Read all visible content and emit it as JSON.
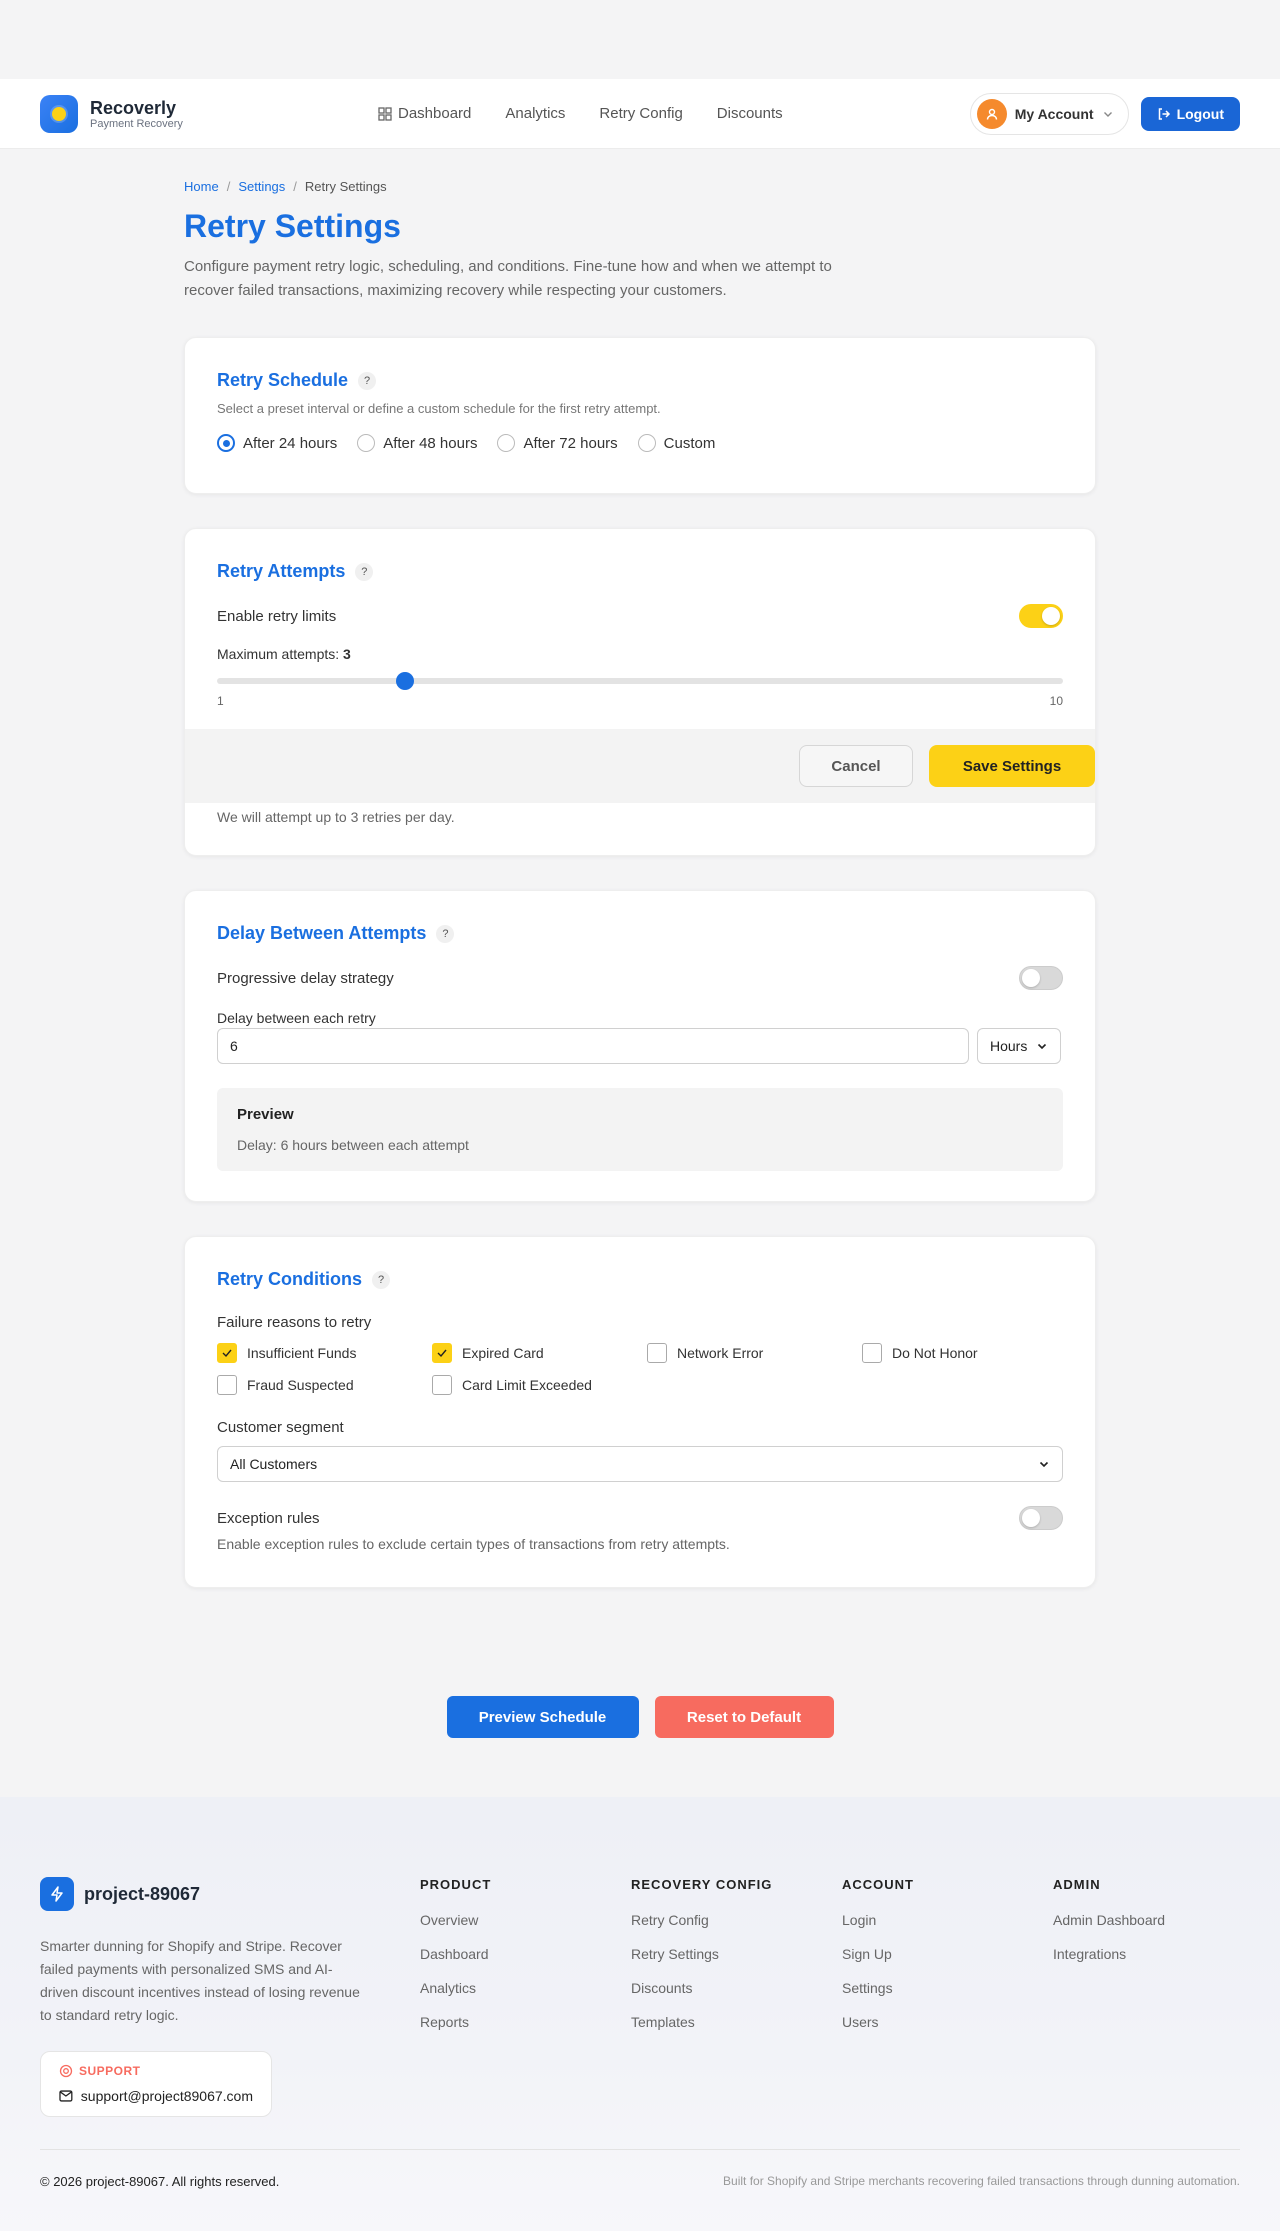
{
  "header": {
    "brand_name": "Recoverly",
    "brand_sub": "Payment Recovery",
    "nav": [
      "Dashboard",
      "Analytics",
      "Retry Config",
      "Discounts"
    ],
    "account_label": "My Account",
    "logout_label": "Logout"
  },
  "breadcrumb": {
    "home": "Home",
    "settings": "Settings",
    "current": "Retry Settings"
  },
  "page": {
    "title": "Retry Settings",
    "intro": "Configure payment retry logic, scheduling, and conditions. Fine-tune how and when we attempt to recover failed transactions, maximizing recovery while respecting your customers."
  },
  "schedule": {
    "title": "Retry Schedule",
    "help": "?",
    "desc": "Select a preset interval or define a custom schedule for the first retry attempt.",
    "options": [
      "After 24 hours",
      "After 48 hours",
      "After 72 hours",
      "Custom"
    ],
    "selected": "After 24 hours"
  },
  "attempts": {
    "title": "Retry Attempts",
    "help": "?",
    "enable_label": "Enable retry limits",
    "enabled": true,
    "max_label": "Maximum attempts:",
    "max_value": "3",
    "min": "1",
    "max": "10",
    "note": "We will attempt up to 3 retries per day.",
    "cancel": "Cancel",
    "save": "Save Settings"
  },
  "delay": {
    "title": "Delay Between Attempts",
    "help": "?",
    "progressive_label": "Progressive delay strategy",
    "progressive": false,
    "each_label": "Delay between each retry",
    "value": "6",
    "unit": "Hours",
    "preview_title": "Preview",
    "preview_text": "Delay: 6 hours between each attempt"
  },
  "conditions": {
    "title": "Retry Conditions",
    "help": "?",
    "reasons_label": "Failure reasons to retry",
    "reasons": [
      {
        "label": "Insufficient Funds",
        "checked": true
      },
      {
        "label": "Expired Card",
        "checked": true
      },
      {
        "label": "Network Error",
        "checked": false
      },
      {
        "label": "Do Not Honor",
        "checked": false
      },
      {
        "label": "Fraud Suspected",
        "checked": false
      },
      {
        "label": "Card Limit Exceeded",
        "checked": false
      }
    ],
    "segment_label": "Customer segment",
    "segment_value": "All Customers",
    "exception_label": "Exception rules",
    "exception_desc": "Enable exception rules to exclude certain types of transactions from retry attempts."
  },
  "actions": {
    "preview": "Preview Schedule",
    "reset": "Reset to Default"
  },
  "footer": {
    "brand": "project-89067",
    "desc": "Smarter dunning for Shopify and Stripe. Recover failed payments with personalized SMS and AI-driven discount incentives instead of losing revenue to standard retry logic.",
    "support_label": "SUPPORT",
    "support_email": "support@project89067.com",
    "columns": [
      {
        "title": "PRODUCT",
        "links": [
          "Overview",
          "Dashboard",
          "Analytics",
          "Reports"
        ]
      },
      {
        "title": "RECOVERY CONFIG",
        "links": [
          "Retry Config",
          "Retry Settings",
          "Discounts",
          "Templates"
        ]
      },
      {
        "title": "ACCOUNT",
        "links": [
          "Login",
          "Sign Up",
          "Settings",
          "Users"
        ]
      },
      {
        "title": "ADMIN",
        "links": [
          "Admin Dashboard",
          "Integrations"
        ]
      }
    ],
    "copyright": "© 2026 project-89067. All rights reserved.",
    "built": "Built for Shopify and Stripe merchants recovering failed transactions through dunning automation."
  },
  "colors": {
    "primary": "#1a6fe0",
    "accent": "#fcd116",
    "danger": "#f76b5f"
  }
}
